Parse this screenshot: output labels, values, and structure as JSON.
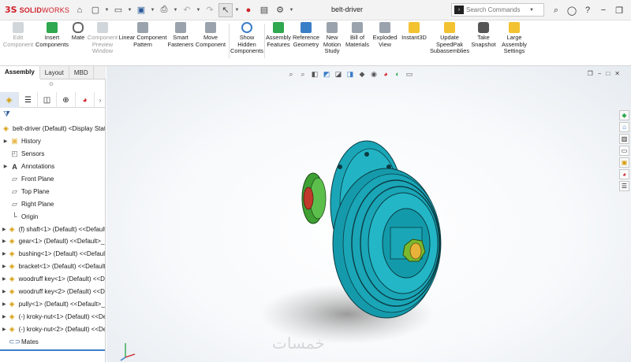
{
  "app": {
    "logo_mark": "3S",
    "logo_bold": "SOLID",
    "logo_thin": "WORKS",
    "document_title": "belt-driver"
  },
  "search": {
    "placeholder": "Search Commands"
  },
  "ribbon": [
    {
      "label": "Edit\nComponent",
      "icon": "edit-component-icon",
      "enabled": false
    },
    {
      "label": "Insert\nComponents",
      "icon": "insert-components-icon",
      "enabled": true
    },
    {
      "label": "Mate",
      "icon": "mate-icon",
      "enabled": true
    },
    {
      "label": "Component\nPreview\nWindow",
      "icon": "component-preview-icon",
      "enabled": false
    },
    {
      "label": "Linear Component\nPattern",
      "icon": "linear-pattern-icon",
      "enabled": true
    },
    {
      "label": "Smart\nFasteners",
      "icon": "smart-fasteners-icon",
      "enabled": true
    },
    {
      "label": "Move\nComponent",
      "icon": "move-component-icon",
      "enabled": true
    },
    {
      "label": "Show\nHidden\nComponents",
      "icon": "show-hidden-icon",
      "enabled": true
    },
    {
      "label": "Assembly\nFeatures",
      "icon": "assembly-features-icon",
      "enabled": true
    },
    {
      "label": "Reference\nGeometry",
      "icon": "reference-geometry-icon",
      "enabled": true
    },
    {
      "label": "New\nMotion\nStudy",
      "icon": "motion-study-icon",
      "enabled": true
    },
    {
      "label": "Bill of\nMaterials",
      "icon": "bill-of-materials-icon",
      "enabled": true
    },
    {
      "label": "Exploded\nView",
      "icon": "exploded-view-icon",
      "enabled": true
    },
    {
      "label": "Instant3D",
      "icon": "instant3d-icon",
      "enabled": true
    },
    {
      "label": "Update\nSpeedPak\nSubassemblies",
      "icon": "speedpak-icon",
      "enabled": true
    },
    {
      "label": "Take\nSnapshot",
      "icon": "snapshot-icon",
      "enabled": true
    },
    {
      "label": "Large\nAssembly\nSettings",
      "icon": "large-assembly-icon",
      "enabled": true
    }
  ],
  "tabs": [
    "Assembly",
    "Layout",
    "MBD"
  ],
  "tree": [
    {
      "label": "belt-driver (Default) <Display State-1>",
      "icon": "assembly-icon",
      "expandable": false
    },
    {
      "label": "History",
      "icon": "history-icon",
      "expandable": true
    },
    {
      "label": "Sensors",
      "icon": "sensors-icon",
      "expandable": false
    },
    {
      "label": "Annotations",
      "icon": "annotations-icon",
      "expandable": true
    },
    {
      "label": "Front Plane",
      "icon": "plane-icon",
      "expandable": false
    },
    {
      "label": "Top Plane",
      "icon": "plane-icon",
      "expandable": false
    },
    {
      "label": "Right Plane",
      "icon": "plane-icon",
      "expandable": false
    },
    {
      "label": "Origin",
      "icon": "origin-icon",
      "expandable": false
    },
    {
      "label": "(f) shaft<1> (Default) <<Default>_Di",
      "icon": "part-icon",
      "expandable": true
    },
    {
      "label": "gear<1> (Default) <<Default>_Dis",
      "icon": "part-icon",
      "expandable": true
    },
    {
      "label": "bushing<1> (Default) <<Default>_D",
      "icon": "part-icon",
      "expandable": true
    },
    {
      "label": "bracket<1> (Default) <<Default>_D",
      "icon": "part-icon",
      "expandable": true
    },
    {
      "label": "woodruff key<1> (Default) <<Def",
      "icon": "part-icon",
      "expandable": true
    },
    {
      "label": "woodruff key<2> (Default) <<Def",
      "icon": "part-icon",
      "expandable": true
    },
    {
      "label": "pully<1> (Default) <<Default>_Di",
      "icon": "part-icon",
      "expandable": true
    },
    {
      "label": "(-) kroky-nut<1> (Default) <<Def",
      "icon": "part-icon",
      "expandable": true
    },
    {
      "label": "(-) kroky-nut<2> (Default) <<Def",
      "icon": "part-icon",
      "expandable": true
    },
    {
      "label": "Mates",
      "icon": "mates-icon",
      "expandable": false
    }
  ],
  "watermark": "خمسات",
  "colors": {
    "brand": "#d0202a",
    "model": "#1aa6b7",
    "accent": "#3a7ec8"
  }
}
